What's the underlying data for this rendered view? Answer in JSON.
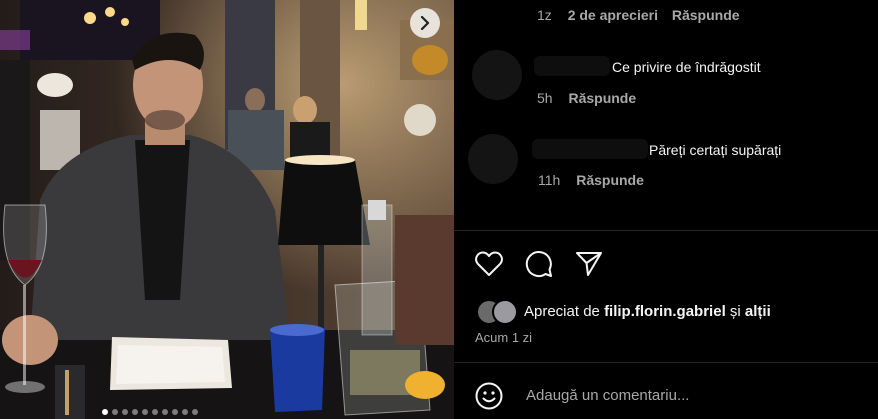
{
  "post": {
    "image_alt": "Photo: man in dark blazer seated at a restaurant table",
    "next_icon": "chevron-right-icon",
    "carousel_dots": 10
  },
  "comments": [
    {
      "time": "1z",
      "likes": "2 de aprecieri",
      "reply": "Răspunde",
      "text": ""
    },
    {
      "time": "5h",
      "likes": "",
      "reply": "Răspunde",
      "text": "Ce privire de îndrăgostit"
    },
    {
      "time": "11h",
      "likes": "",
      "reply": "Răspunde",
      "text": "Păreți certați supărați"
    }
  ],
  "actions": {
    "like_icon": "heart-icon",
    "comment_icon": "comment-bubble-icon",
    "share_icon": "send-icon"
  },
  "likes": {
    "prefix": "Apreciat de",
    "user": "filip.florin.gabriel",
    "joiner": "și",
    "others": "alții"
  },
  "timestamp": "Acum 1 zi",
  "add_comment": {
    "emoji_icon": "smiley-icon",
    "placeholder": "Adaugă un comentariu..."
  }
}
